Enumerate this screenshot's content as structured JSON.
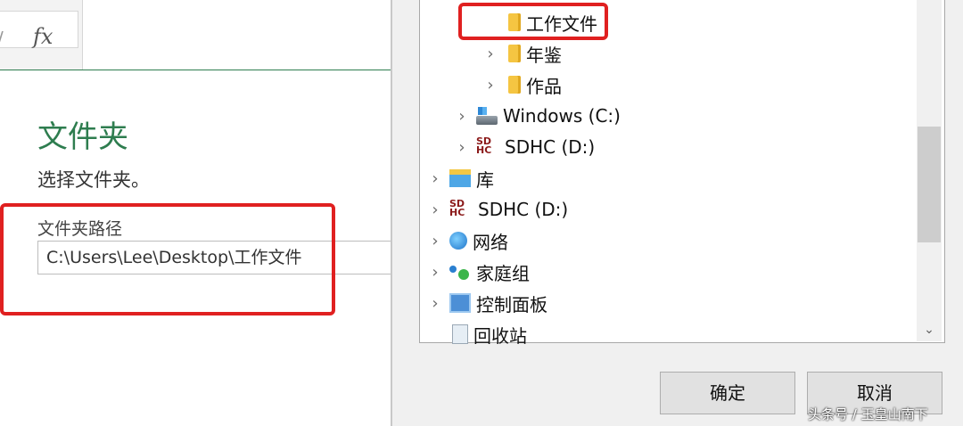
{
  "formula_bar": {
    "fx_label": "fx",
    "separator": "/"
  },
  "panel": {
    "title": "文件夹",
    "description": "选择文件夹。",
    "path_label": "文件夹路径",
    "path_value": "C:\\Users\\Lee\\Desktop\\工作文件"
  },
  "dialog": {
    "tree": [
      {
        "label": "工作文件",
        "icon": "folder-icon",
        "chevron": ""
      },
      {
        "label": "年鉴",
        "icon": "folder-icon",
        "chevron": "›"
      },
      {
        "label": "作品",
        "icon": "folder-icon",
        "chevron": "›"
      },
      {
        "label": "Windows (C:)",
        "icon": "drive-icon",
        "chevron": "›"
      },
      {
        "label": "SDHC (D:)",
        "icon": "sd-card-icon",
        "chevron": "›"
      },
      {
        "label": "库",
        "icon": "library-icon",
        "chevron": "›"
      },
      {
        "label": "SDHC (D:)",
        "icon": "sd-card-icon",
        "chevron": "›"
      },
      {
        "label": "网络",
        "icon": "network-icon",
        "chevron": "›"
      },
      {
        "label": "家庭组",
        "icon": "homegroup-icon",
        "chevron": "›"
      },
      {
        "label": "控制面板",
        "icon": "control-panel-icon",
        "chevron": "›"
      },
      {
        "label": "回收站",
        "icon": "recycle-bin-icon",
        "chevron": ""
      }
    ],
    "ok_label": "确定",
    "cancel_label": "取消",
    "scroll_down_glyph": "⌄"
  },
  "watermark": "头条号 / 玉皇山南下",
  "colors": {
    "accent_green": "#2e7d4f",
    "highlight_red": "#e02020"
  }
}
